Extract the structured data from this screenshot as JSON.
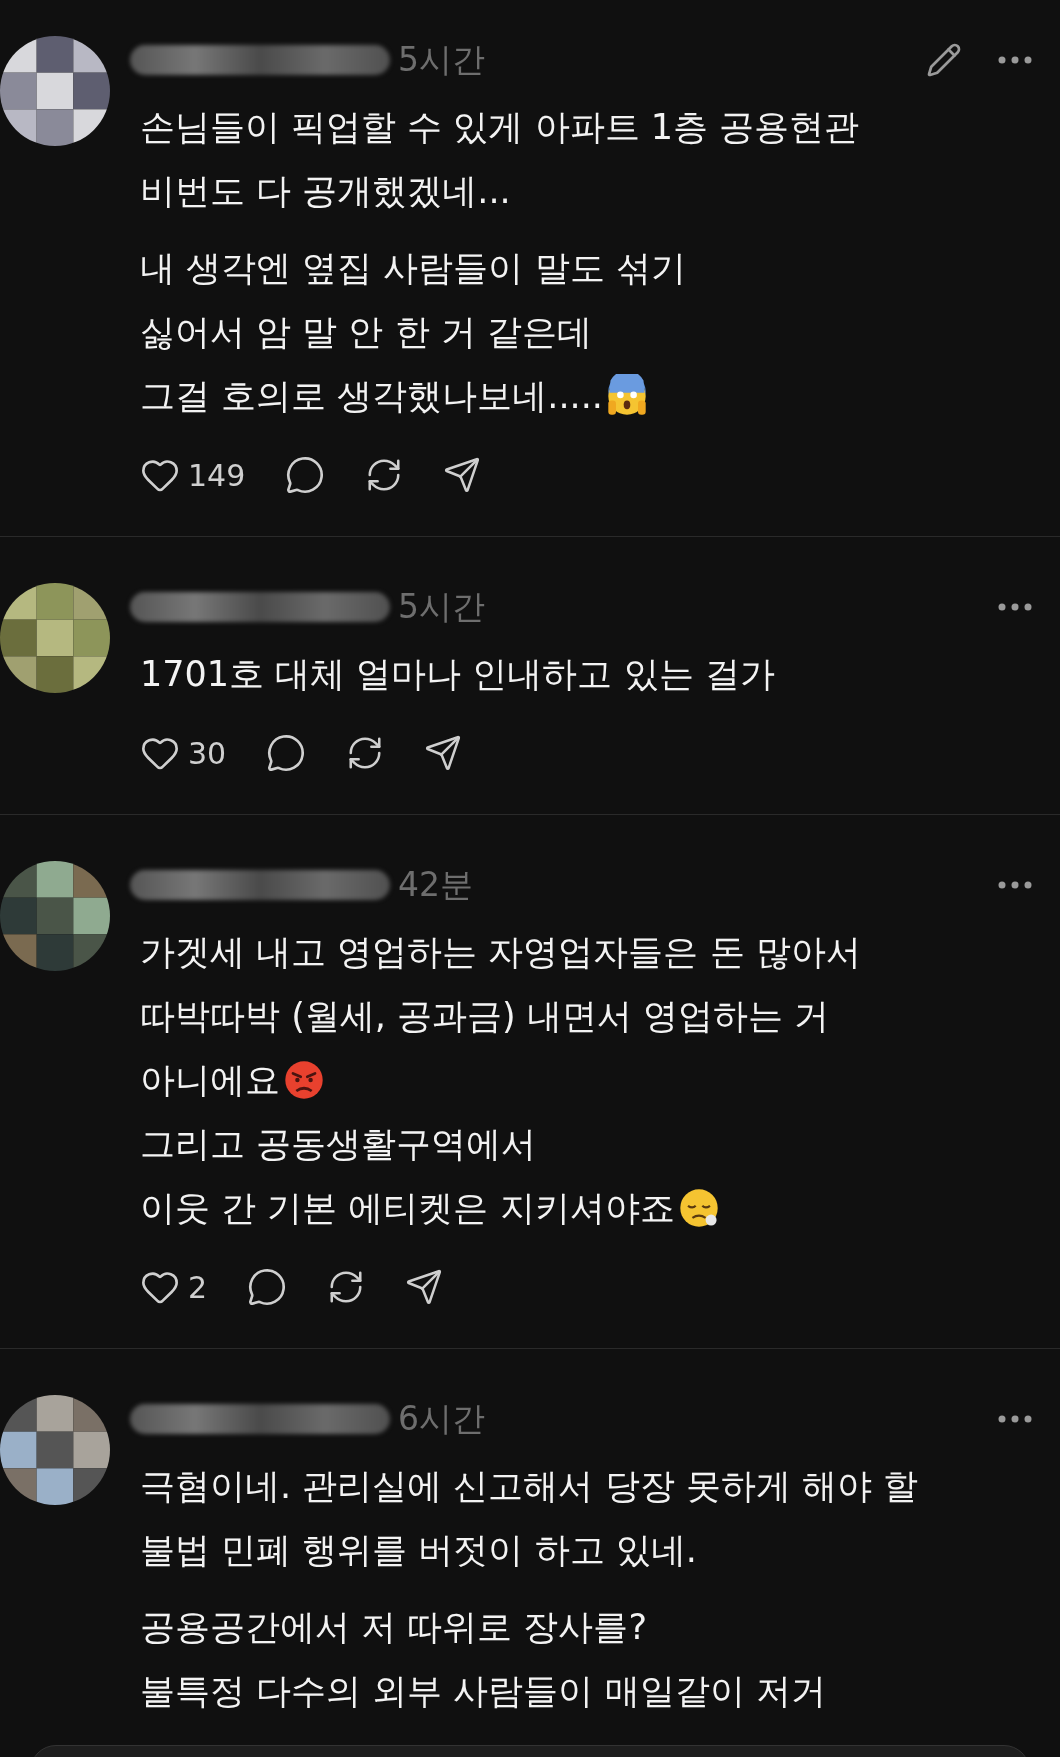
{
  "posts": [
    {
      "time": "5시간",
      "editable": true,
      "paragraphs": [
        [
          {
            "text": "손님들이 픽업할 수 있게 아파트 1층 공용현관",
            "kind": "plain"
          },
          {
            "text": "비번도 다 공개했겠네...",
            "kind": "plain"
          }
        ],
        [
          {
            "text": "내 생각엔 옆집 사람들이 말도 섞기",
            "kind": "plain"
          },
          {
            "text": "싫어서 암 말 안 한 거 같은데",
            "kind": "plain"
          },
          {
            "text": "그걸 호의로 생각했나보네.....",
            "kind": "scream"
          }
        ]
      ],
      "likes": "149"
    },
    {
      "time": "5시간",
      "paragraphs": [
        [
          {
            "text": "1701호 대체 얼마나 인내하고 있는 걸가",
            "kind": "plain"
          }
        ]
      ],
      "likes": "30"
    },
    {
      "time": "42분",
      "paragraphs": [
        [
          {
            "text": "가겟세 내고 영업하는 자영업자들은 돈 많아서",
            "kind": "plain"
          },
          {
            "text": "따박따박 (월세, 공과금) 내면서 영업하는 거",
            "kind": "plain"
          },
          {
            "text": "아니에요",
            "kind": "angry"
          },
          {
            "text": "그리고 공동생활구역에서",
            "kind": "plain"
          },
          {
            "text": "이웃 간 기본 에티켓은 지키셔야죠",
            "kind": "tired"
          }
        ]
      ],
      "likes": "2"
    },
    {
      "time": "6시간",
      "paragraphs": [
        [
          {
            "text": "극혐이네. 관리실에 신고해서 당장 못하게 해야 할",
            "kind": "plain"
          },
          {
            "text": "불법 민폐 행위를 버젓이 하고 있네.",
            "kind": "plain"
          }
        ],
        [
          {
            "text": "공용공간에서 저 따위로 장사를?",
            "kind": "plain"
          },
          {
            "text": "불특정 다수의 외부 사람들이 매일같이 저거",
            "kind": "plain"
          }
        ]
      ]
    }
  ]
}
